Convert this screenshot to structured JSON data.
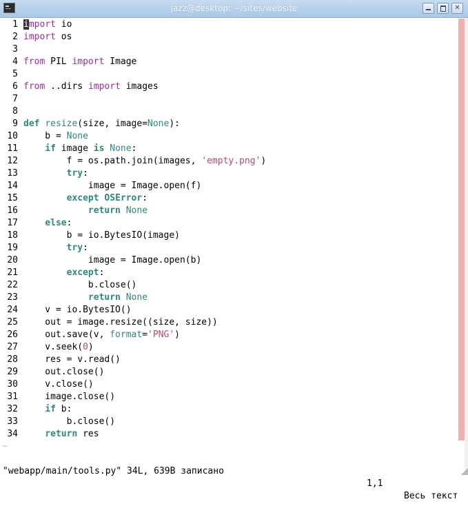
{
  "window": {
    "title": "jazz@desktop: ~/sites/website",
    "buttons": {
      "minimize": "",
      "maximize": "",
      "close": "✕"
    },
    "app_icon": "terminal-icon"
  },
  "editor": {
    "lines": [
      {
        "n": "1",
        "tokens": [
          [
            "k",
            "import"
          ],
          [
            "t",
            " io"
          ]
        ],
        "cursor_char": "i"
      },
      {
        "n": "2",
        "tokens": [
          [
            "k",
            "import"
          ],
          [
            "t",
            " os"
          ]
        ]
      },
      {
        "n": "3",
        "tokens": []
      },
      {
        "n": "4",
        "tokens": [
          [
            "k",
            "from"
          ],
          [
            "t",
            " PIL "
          ],
          [
            "k",
            "import"
          ],
          [
            "t",
            " Image"
          ]
        ]
      },
      {
        "n": "5",
        "tokens": []
      },
      {
        "n": "6",
        "tokens": [
          [
            "k",
            "from"
          ],
          [
            "t",
            " ..dirs "
          ],
          [
            "k",
            "import"
          ],
          [
            "t",
            " images"
          ]
        ]
      },
      {
        "n": "7",
        "tokens": []
      },
      {
        "n": "8",
        "tokens": []
      },
      {
        "n": "9",
        "tokens": [
          [
            "kw",
            "def"
          ],
          [
            "t",
            " "
          ],
          [
            "fn",
            "resize"
          ],
          [
            "t",
            "(size, image="
          ],
          [
            "bi",
            "None"
          ],
          [
            "t",
            "):"
          ]
        ]
      },
      {
        "n": "10",
        "tokens": [
          [
            "t",
            "    b = "
          ],
          [
            "bi",
            "None"
          ]
        ]
      },
      {
        "n": "11",
        "tokens": [
          [
            "t",
            "    "
          ],
          [
            "kw",
            "if"
          ],
          [
            "t",
            " image "
          ],
          [
            "kw",
            "is"
          ],
          [
            "t",
            " "
          ],
          [
            "bi",
            "None"
          ],
          [
            "t",
            ":"
          ]
        ]
      },
      {
        "n": "12",
        "tokens": [
          [
            "t",
            "        f = os.path.join(images, "
          ],
          [
            "st",
            "'empty.png'"
          ],
          [
            "t",
            ")"
          ]
        ]
      },
      {
        "n": "13",
        "tokens": [
          [
            "t",
            "        "
          ],
          [
            "kw",
            "try"
          ],
          [
            "t",
            ":"
          ]
        ]
      },
      {
        "n": "14",
        "tokens": [
          [
            "t",
            "            image = Image.open(f)"
          ]
        ]
      },
      {
        "n": "15",
        "tokens": [
          [
            "t",
            "        "
          ],
          [
            "kw",
            "except"
          ],
          [
            "t",
            " "
          ],
          [
            "kw",
            "OSError"
          ],
          [
            "t",
            ":"
          ]
        ]
      },
      {
        "n": "16",
        "tokens": [
          [
            "t",
            "            "
          ],
          [
            "kw",
            "return"
          ],
          [
            "t",
            " "
          ],
          [
            "bi",
            "None"
          ]
        ]
      },
      {
        "n": "17",
        "tokens": [
          [
            "t",
            "    "
          ],
          [
            "kw",
            "else"
          ],
          [
            "t",
            ":"
          ]
        ]
      },
      {
        "n": "18",
        "tokens": [
          [
            "t",
            "        b = io.BytesIO(image)"
          ]
        ]
      },
      {
        "n": "19",
        "tokens": [
          [
            "t",
            "        "
          ],
          [
            "kw",
            "try"
          ],
          [
            "t",
            ":"
          ]
        ]
      },
      {
        "n": "20",
        "tokens": [
          [
            "t",
            "            image = Image.open(b)"
          ]
        ]
      },
      {
        "n": "21",
        "tokens": [
          [
            "t",
            "        "
          ],
          [
            "kw",
            "except"
          ],
          [
            "t",
            ":"
          ]
        ]
      },
      {
        "n": "22",
        "tokens": [
          [
            "t",
            "            b.close()"
          ]
        ]
      },
      {
        "n": "23",
        "tokens": [
          [
            "t",
            "            "
          ],
          [
            "kw",
            "return"
          ],
          [
            "t",
            " "
          ],
          [
            "bi",
            "None"
          ]
        ]
      },
      {
        "n": "24",
        "tokens": [
          [
            "t",
            "    v = io.BytesIO()"
          ]
        ]
      },
      {
        "n": "25",
        "tokens": [
          [
            "t",
            "    out = image.resize((size, size))"
          ]
        ]
      },
      {
        "n": "26",
        "tokens": [
          [
            "t",
            "    out.save(v, "
          ],
          [
            "pm",
            "format"
          ],
          [
            "t",
            "="
          ],
          [
            "st",
            "'PNG'"
          ],
          [
            "t",
            ")"
          ]
        ]
      },
      {
        "n": "27",
        "tokens": [
          [
            "t",
            "    v.seek("
          ],
          [
            "nm",
            "0"
          ],
          [
            "t",
            ")"
          ]
        ]
      },
      {
        "n": "28",
        "tokens": [
          [
            "t",
            "    res = v.read()"
          ]
        ]
      },
      {
        "n": "29",
        "tokens": [
          [
            "t",
            "    out.close()"
          ]
        ]
      },
      {
        "n": "30",
        "tokens": [
          [
            "t",
            "    v.close()"
          ]
        ]
      },
      {
        "n": "31",
        "tokens": [
          [
            "t",
            "    image.close()"
          ]
        ]
      },
      {
        "n": "32",
        "tokens": [
          [
            "t",
            "    "
          ],
          [
            "kw",
            "if"
          ],
          [
            "t",
            " b:"
          ]
        ]
      },
      {
        "n": "33",
        "tokens": [
          [
            "t",
            "        b.close()"
          ]
        ]
      },
      {
        "n": "34",
        "tokens": [
          [
            "t",
            "    "
          ],
          [
            "kw",
            "return"
          ],
          [
            "t",
            " res"
          ]
        ]
      }
    ],
    "tilde": "~"
  },
  "status": {
    "message": "\"webapp/main/tools.py\" 34L, 639B записано",
    "position": "1,1",
    "scroll": "Весь текст"
  },
  "colors": {
    "keyword_purple": "#a626a4",
    "keyword_teal": "#2c8a7b",
    "string": "#b44a76",
    "colorcolumn": "#f3aeb0"
  }
}
